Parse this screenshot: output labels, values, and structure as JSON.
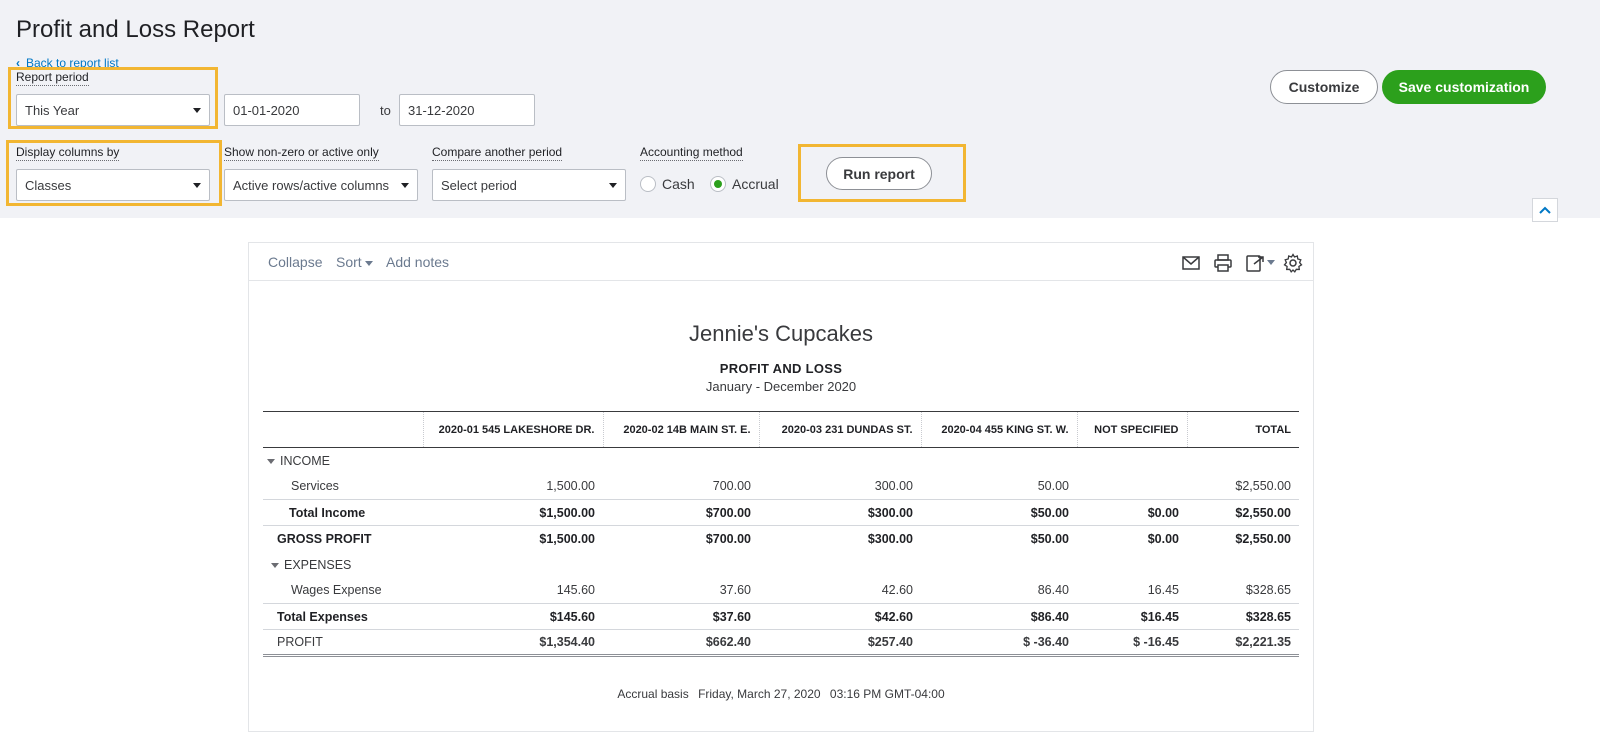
{
  "page": {
    "title": "Profit and Loss Report",
    "back_link": "Back to report list"
  },
  "filters": {
    "report_period_label": "Report period",
    "report_period_value": "This Year",
    "date_from": "01-01-2020",
    "to_label": "to",
    "date_to": "31-12-2020",
    "display_columns_label": "Display columns by",
    "display_columns_value": "Classes",
    "show_nonzero_label": "Show non-zero or active only",
    "show_nonzero_value": "Active rows/active columns",
    "compare_label": "Compare another period",
    "compare_value": "Select period",
    "accounting_label": "Accounting method",
    "cash_label": "Cash",
    "accrual_label": "Accrual",
    "accounting_selected": "Accrual",
    "run_report": "Run report"
  },
  "actions": {
    "customize": "Customize",
    "save_customization": "Save customization"
  },
  "colors": {
    "accent_green": "#2ca01c",
    "link_blue": "#0077c5",
    "highlight": "#f2b632"
  },
  "toolbar": {
    "collapse": "Collapse",
    "sort": "Sort",
    "add_notes": "Add notes",
    "icons": [
      "mail-icon",
      "print-icon",
      "export-icon",
      "settings-gear-icon"
    ]
  },
  "report": {
    "company": "Jennie's Cupcakes",
    "name": "PROFIT AND LOSS",
    "period": "January - December 2020",
    "columns": [
      "",
      "2020-01 545 LAKESHORE DR.",
      "2020-02 14B MAIN ST. E.",
      "2020-03 231 DUNDAS ST.",
      "2020-04 455 KING ST. W.",
      "NOT SPECIFIED",
      "TOTAL"
    ],
    "rows": [
      {
        "label": "INCOME",
        "values": [
          "",
          "",
          "",
          "",
          "",
          ""
        ]
      },
      {
        "label": "Services",
        "values": [
          "1,500.00",
          "700.00",
          "300.00",
          "50.00",
          "",
          "$2,550.00"
        ]
      },
      {
        "label": "Total Income",
        "values": [
          "$1,500.00",
          "$700.00",
          "$300.00",
          "$50.00",
          "$0.00",
          "$2,550.00"
        ]
      },
      {
        "label": "GROSS PROFIT",
        "values": [
          "$1,500.00",
          "$700.00",
          "$300.00",
          "$50.00",
          "$0.00",
          "$2,550.00"
        ]
      },
      {
        "label": "EXPENSES",
        "values": [
          "",
          "",
          "",
          "",
          "",
          ""
        ]
      },
      {
        "label": "Wages Expense",
        "values": [
          "145.60",
          "37.60",
          "42.60",
          "86.40",
          "16.45",
          "$328.65"
        ]
      },
      {
        "label": "Total Expenses",
        "values": [
          "$145.60",
          "$37.60",
          "$42.60",
          "$86.40",
          "$16.45",
          "$328.65"
        ]
      },
      {
        "label": "PROFIT",
        "values": [
          "$1,354.40",
          "$662.40",
          "$257.40",
          "$ -36.40",
          "$ -16.45",
          "$2,221.35"
        ]
      }
    ],
    "footer": {
      "basis": "Accrual basis",
      "date": "Friday, March 27, 2020",
      "time": "03:16 PM GMT-04:00"
    }
  }
}
